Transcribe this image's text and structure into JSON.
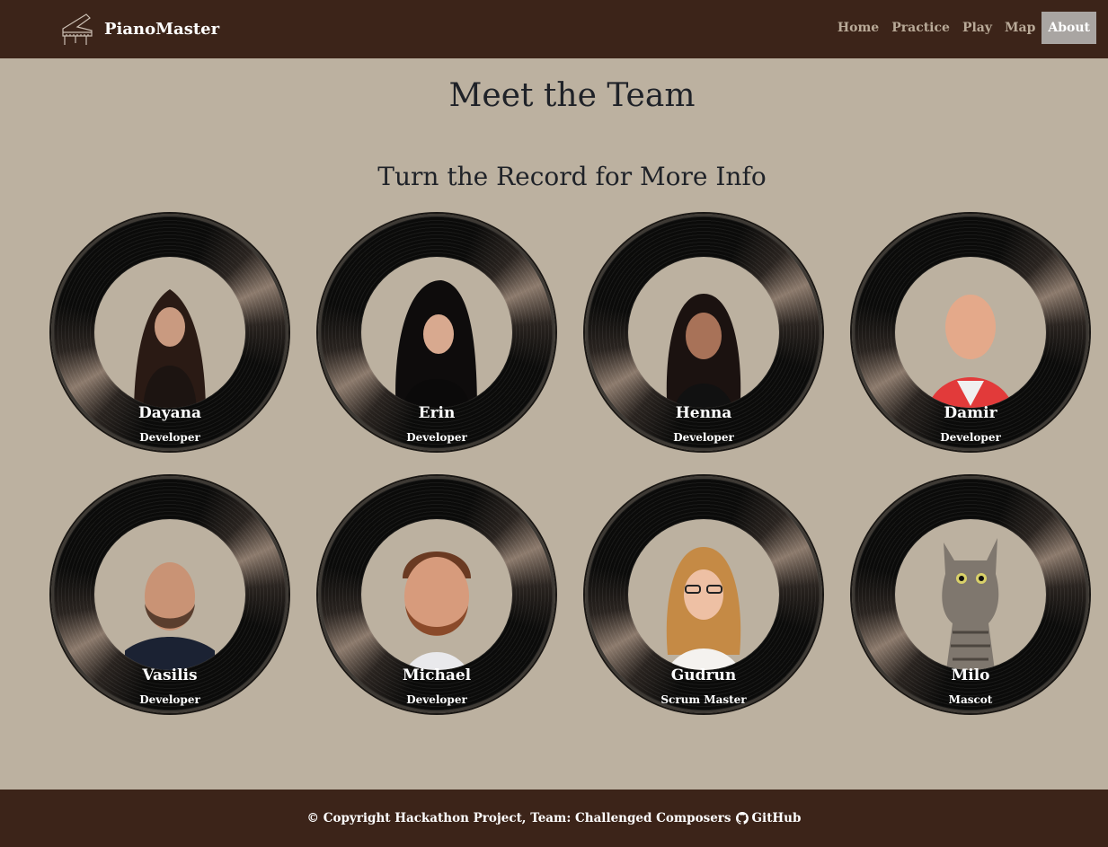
{
  "brand": {
    "name": "PianoMaster"
  },
  "nav": {
    "items": [
      "Home",
      "Practice",
      "Play",
      "Map",
      "About"
    ]
  },
  "page": {
    "title": "Meet the Team",
    "subtitle": "Turn the Record for More Info"
  },
  "team": [
    {
      "name": "Dayana",
      "role": "Developer"
    },
    {
      "name": "Erin",
      "role": "Developer"
    },
    {
      "name": "Henna",
      "role": "Developer"
    },
    {
      "name": "Damir",
      "role": "Developer"
    },
    {
      "name": "Vasilis",
      "role": "Developer"
    },
    {
      "name": "Michael",
      "role": "Developer"
    },
    {
      "name": "Gudrun",
      "role": "Scrum Master"
    },
    {
      "name": "Milo",
      "role": "Mascot"
    }
  ],
  "footer": {
    "copyright": "© Copyright Hackathon Project, Team: Challenged Composers",
    "github_label": "GitHub"
  },
  "colors": {
    "navbar": "#3c2419",
    "background": "#bcb1a0",
    "nav_active": "#a9a5a2",
    "nav_text": "#b9aa98"
  }
}
